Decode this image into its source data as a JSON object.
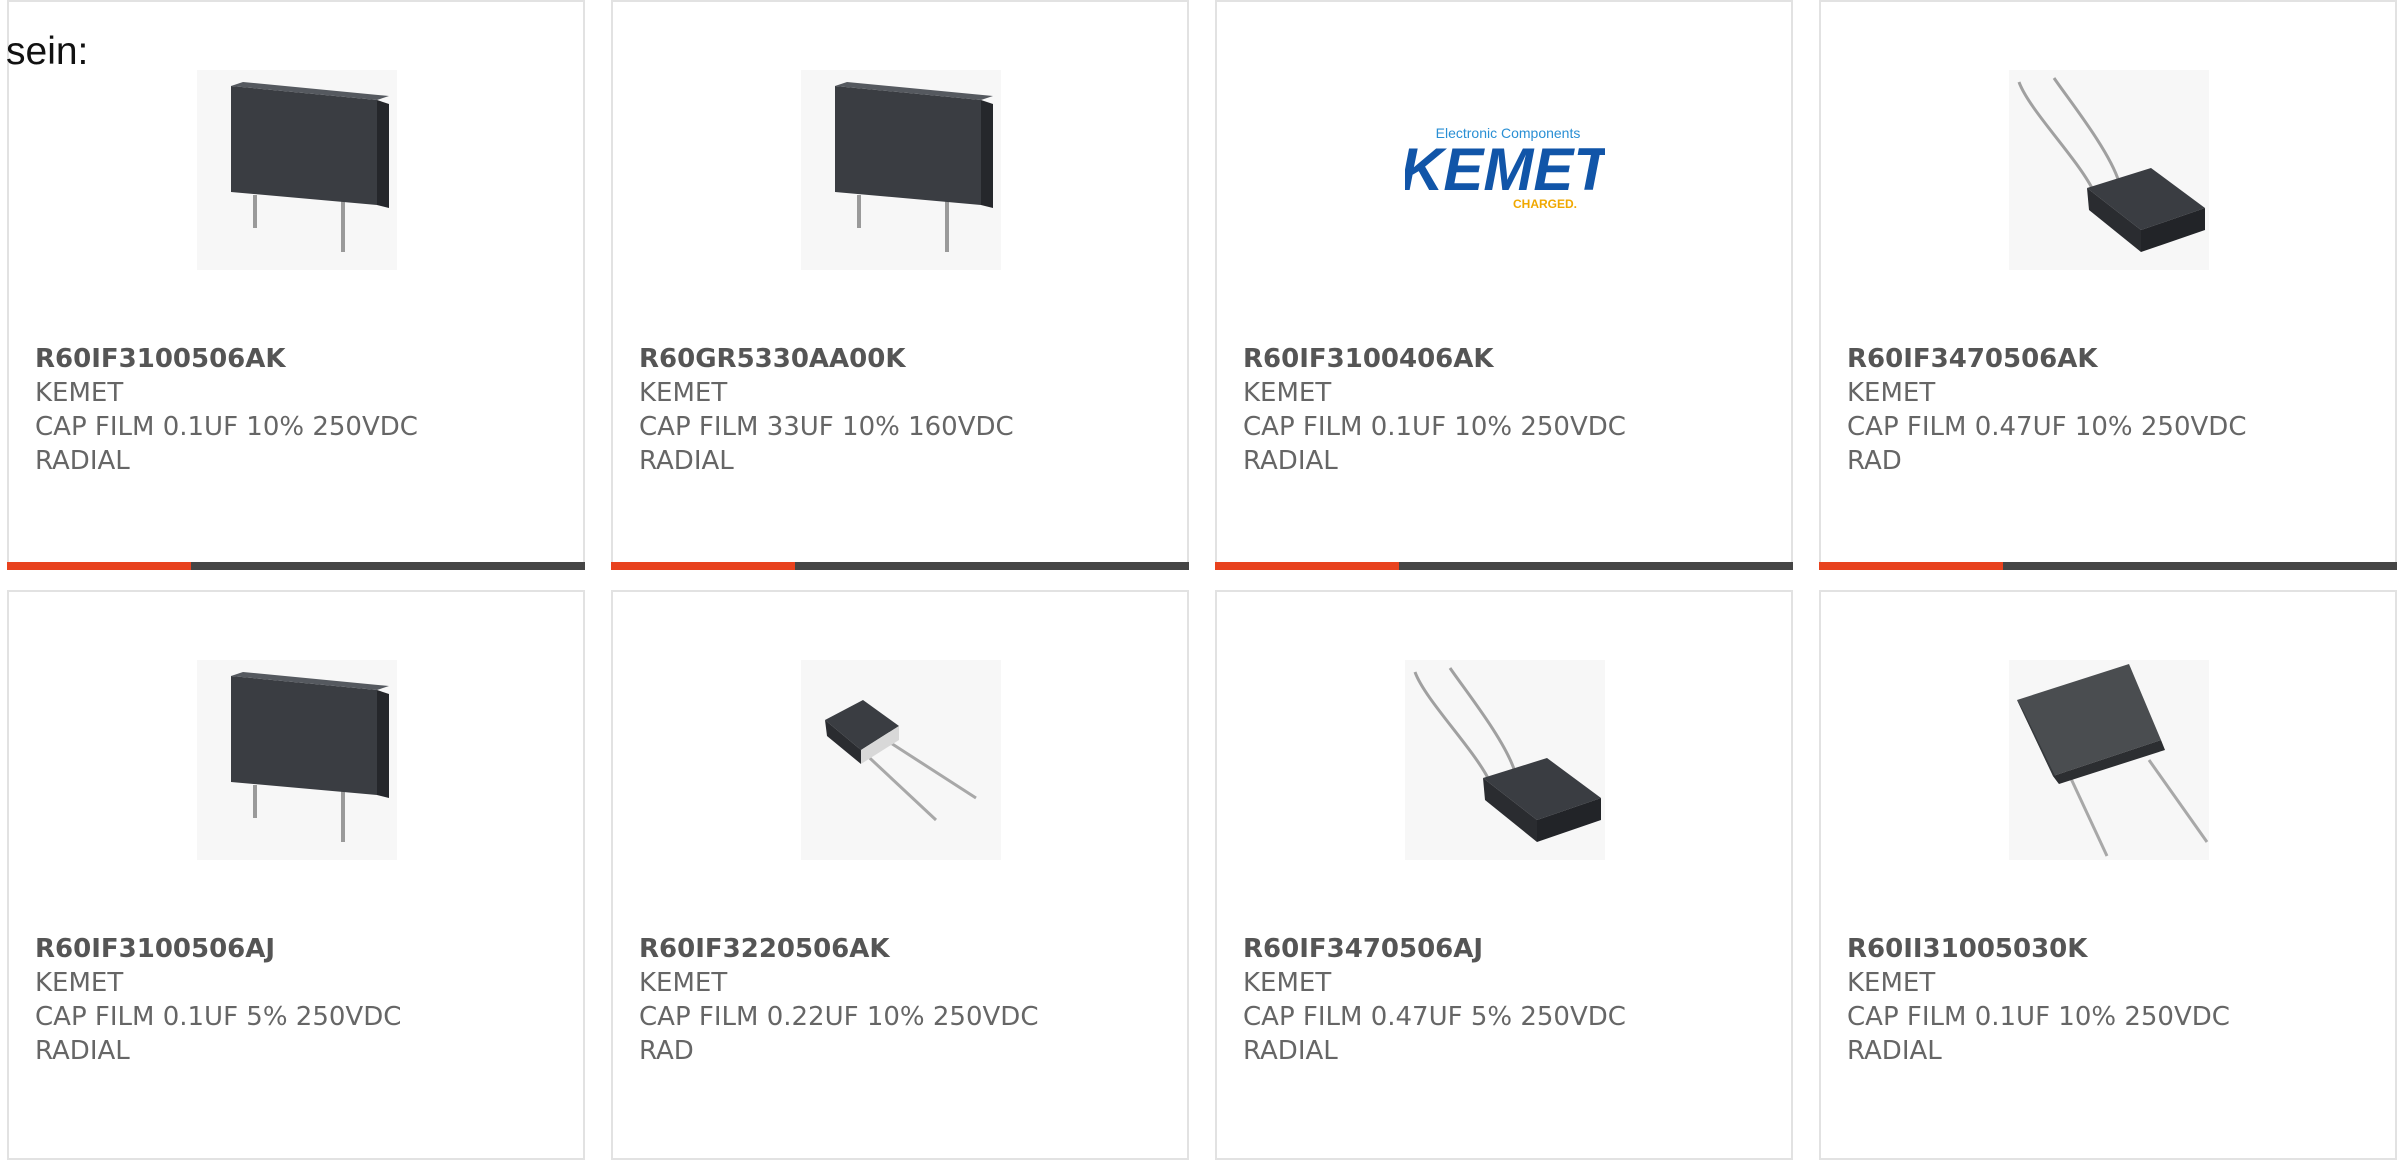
{
  "intro_text": "sein:",
  "colors": {
    "accent": "#e8421e",
    "bar": "#454545",
    "text": "#666666",
    "border": "#e2e2e2"
  },
  "products": [
    {
      "part_number": "R60IF3100506AK",
      "manufacturer": "KEMET",
      "description_line1": "CAP FILM 0.1UF 10% 250VDC",
      "description_line2": "RADIAL",
      "image": "upright-film-capacitor"
    },
    {
      "part_number": "R60GR5330AA00K",
      "manufacturer": "KEMET",
      "description_line1": "CAP FILM 33UF 10% 160VDC",
      "description_line2": "RADIAL",
      "image": "upright-film-capacitor"
    },
    {
      "part_number": "R60IF3100406AK",
      "manufacturer": "KEMET",
      "description_line1": "CAP FILM 0.1UF 10% 250VDC",
      "description_line2": "RADIAL",
      "image": "kemet-logo",
      "logo_tagline": "Electronic Components",
      "logo_name": "KEMET",
      "logo_slogan": "CHARGED."
    },
    {
      "part_number": "R60IF3470506AK",
      "manufacturer": "KEMET",
      "description_line1": "CAP FILM 0.47UF 10% 250VDC",
      "description_line2": "RAD",
      "image": "tilted-film-capacitor-leads-up"
    },
    {
      "part_number": "R60IF3100506AJ",
      "manufacturer": "KEMET",
      "description_line1": "CAP FILM 0.1UF 5% 250VDC",
      "description_line2": "RADIAL",
      "image": "upright-film-capacitor"
    },
    {
      "part_number": "R60IF3220506AK",
      "manufacturer": "KEMET",
      "description_line1": "CAP FILM 0.22UF 10% 250VDC",
      "description_line2": "RAD",
      "image": "small-film-capacitor-leads-down"
    },
    {
      "part_number": "R60IF3470506AJ",
      "manufacturer": "KEMET",
      "description_line1": "CAP FILM 0.47UF 5% 250VDC",
      "description_line2": "RADIAL",
      "image": "tilted-film-capacitor-leads-up"
    },
    {
      "part_number": "R60II31005030K",
      "manufacturer": "KEMET",
      "description_line1": "CAP FILM 0.1UF 10% 250VDC",
      "description_line2": "RADIAL",
      "image": "tilted-film-capacitor-leads-down"
    }
  ]
}
